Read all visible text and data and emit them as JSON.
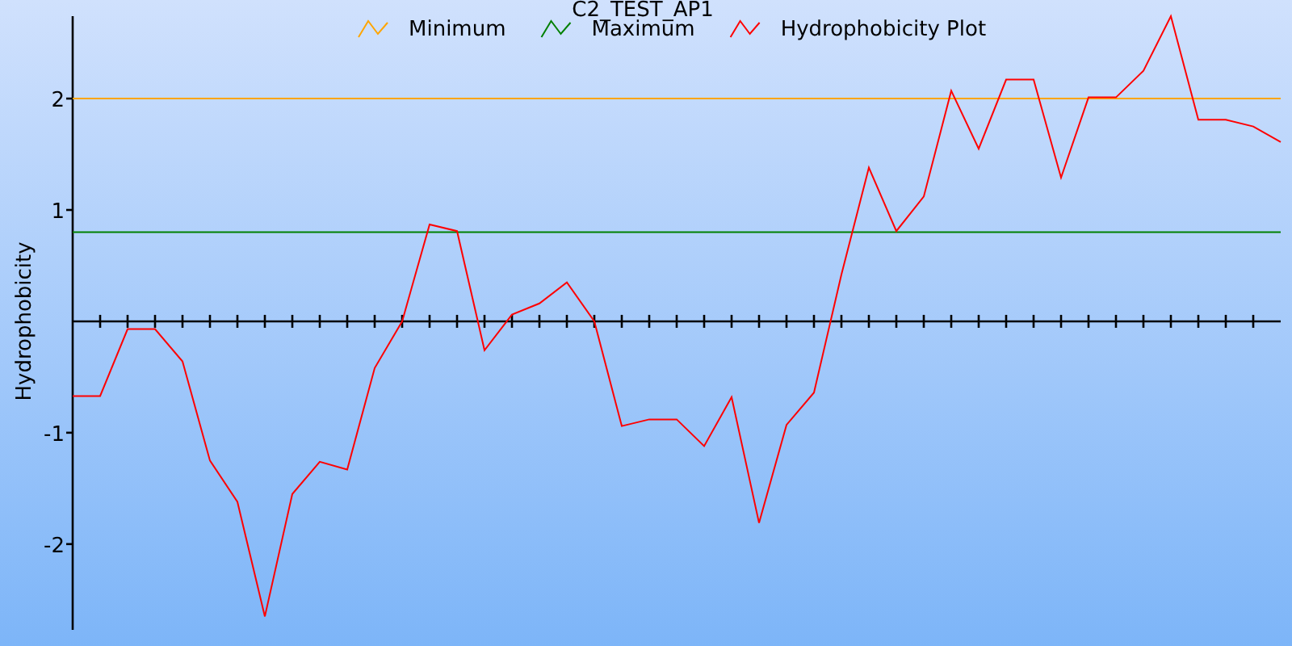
{
  "chart_data": {
    "type": "line",
    "title": "C2_TEST_AP1",
    "ylabel": "Hydrophobicity",
    "legend": "top",
    "categories": [
      null,
      null,
      null,
      null,
      null,
      null,
      null,
      null,
      null,
      null,
      null,
      null,
      null,
      null,
      null,
      null,
      null,
      null,
      null,
      null,
      null,
      null,
      null,
      null,
      null,
      null,
      null,
      null,
      null,
      null,
      null,
      null,
      null,
      null,
      null,
      null,
      null,
      null,
      null,
      null,
      null,
      null,
      null,
      null,
      null
    ],
    "ylim": [
      -2.77,
      2.74
    ],
    "yticks": [
      {
        "value": -2,
        "label": "-2"
      },
      {
        "value": -1,
        "label": "-1"
      },
      {
        "value": 1,
        "label": "1"
      },
      {
        "value": 2,
        "label": "2"
      }
    ],
    "series": [
      {
        "name": "Minimum",
        "color": "#ffa500",
        "values": [
          2,
          2,
          2,
          2,
          2,
          2,
          2,
          2,
          2,
          2,
          2,
          2,
          2,
          2,
          2,
          2,
          2,
          2,
          2,
          2,
          2,
          2,
          2,
          2,
          2,
          2,
          2,
          2,
          2,
          2,
          2,
          2,
          2,
          2,
          2,
          2,
          2,
          2,
          2,
          2,
          2,
          2,
          2,
          2,
          2
        ]
      },
      {
        "name": "Maximum",
        "color": "#008000",
        "values": [
          0.8,
          0.8,
          0.8,
          0.8,
          0.8,
          0.8,
          0.8,
          0.8,
          0.8,
          0.8,
          0.8,
          0.8,
          0.8,
          0.8,
          0.8,
          0.8,
          0.8,
          0.8,
          0.8,
          0.8,
          0.8,
          0.8,
          0.8,
          0.8,
          0.8,
          0.8,
          0.8,
          0.8,
          0.8,
          0.8,
          0.8,
          0.8,
          0.8,
          0.8,
          0.8,
          0.8,
          0.8,
          0.8,
          0.8,
          0.8,
          0.8,
          0.8,
          0.8,
          0.8,
          0.8
        ]
      },
      {
        "name": "Hydrophobicity Plot",
        "color": "#ff0000",
        "values": [
          -0.67,
          -0.67,
          -0.07,
          -0.07,
          -0.36,
          -1.25,
          -1.62,
          -2.65,
          -1.55,
          -1.26,
          -1.33,
          -0.42,
          0.0,
          0.87,
          0.81,
          -0.26,
          0.06,
          0.16,
          0.35,
          0.0,
          -0.94,
          -0.88,
          -0.88,
          -1.12,
          -0.68,
          -1.81,
          -0.93,
          -0.64,
          0.42,
          1.38,
          0.81,
          1.12,
          2.07,
          1.55,
          2.17,
          2.17,
          1.29,
          2.01,
          2.01,
          2.25,
          2.74,
          1.81,
          1.81,
          1.75,
          1.61
        ]
      }
    ]
  }
}
